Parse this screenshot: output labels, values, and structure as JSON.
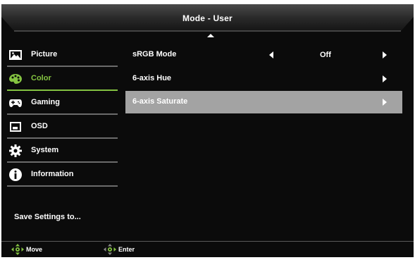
{
  "header": {
    "title": "Mode - User"
  },
  "sidebar": {
    "items": [
      {
        "label": "Picture",
        "icon": "picture-icon",
        "active": false
      },
      {
        "label": "Color",
        "icon": "palette-icon",
        "active": true
      },
      {
        "label": "Gaming",
        "icon": "gamepad-icon",
        "active": false
      },
      {
        "label": "OSD",
        "icon": "osd-window-icon",
        "active": false
      },
      {
        "label": "System",
        "icon": "gear-icon",
        "active": false
      },
      {
        "label": "Information",
        "icon": "info-icon",
        "active": false
      }
    ],
    "save_settings": "Save Settings to..."
  },
  "main": {
    "rows": [
      {
        "label": "sRGB Mode",
        "value": "Off",
        "selected": false
      },
      {
        "label": "6-axis Hue",
        "selected": false
      },
      {
        "label": "6-axis Saturate",
        "selected": true
      }
    ]
  },
  "footer": {
    "move_label": "Move",
    "enter_label": "Enter"
  },
  "colors": {
    "accent": "#84c341",
    "selected_row": "#a3a3a3",
    "background": "#0b0b0b",
    "divider": "#6b6b6b"
  }
}
